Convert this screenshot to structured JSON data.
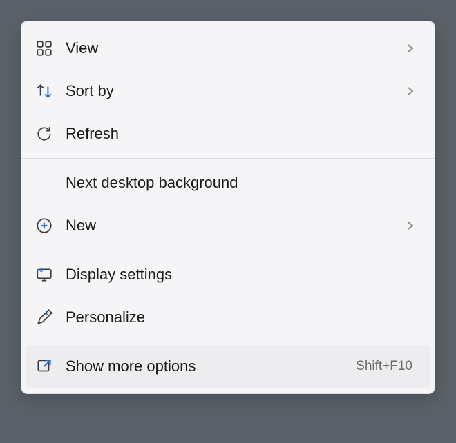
{
  "menu": {
    "view": {
      "label": "View",
      "has_submenu": true
    },
    "sort_by": {
      "label": "Sort by",
      "has_submenu": true
    },
    "refresh": {
      "label": "Refresh",
      "has_submenu": false
    },
    "next_bg": {
      "label": "Next desktop background",
      "has_submenu": false
    },
    "new": {
      "label": "New",
      "has_submenu": true
    },
    "display_settings": {
      "label": "Display settings",
      "has_submenu": false
    },
    "personalize": {
      "label": "Personalize",
      "has_submenu": false
    },
    "show_more": {
      "label": "Show more options",
      "shortcut": "Shift+F10",
      "has_submenu": false
    }
  }
}
